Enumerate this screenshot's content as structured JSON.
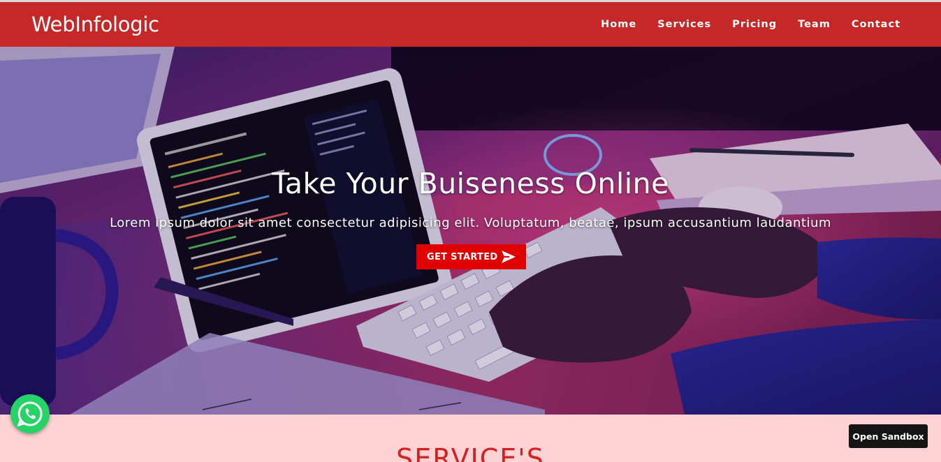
{
  "navbar": {
    "brand": "WebInfologic",
    "links": [
      "Home",
      "Services",
      "Pricing",
      "Team",
      "Contact"
    ]
  },
  "hero": {
    "title": "Take Your Buiseness Online",
    "subtitle": "Lorem ipsum dolor sit amet consectetur adipisicing elit. Voluptatum, beatae, ipsum accusantium laudantium",
    "cta_label": "GET STARTED"
  },
  "services": {
    "title": "SERVICE'S"
  },
  "floating": {
    "whatsapp_icon": "whatsapp-icon",
    "sandbox_label": "Open Sandbox"
  },
  "colors": {
    "nav_bg": "#c62828",
    "cta_bg": "#e00000",
    "services_bg": "#ffd3d3",
    "services_title": "#d62020",
    "whatsapp": "#25d366"
  }
}
